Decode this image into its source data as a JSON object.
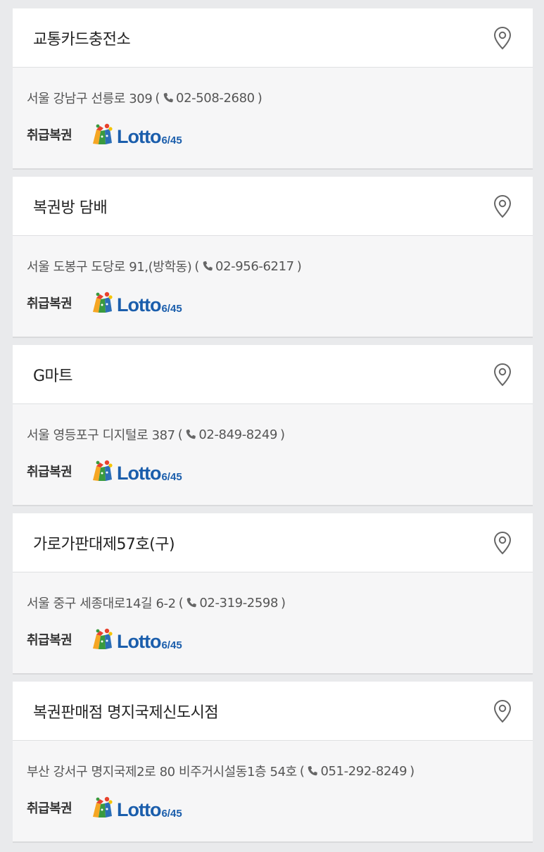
{
  "stores": [
    {
      "name": "교통카드충전소",
      "address": "서울 강남구 선릉로 309",
      "phone": "02-508-2680",
      "products_label": "취급복권",
      "product": "Lotto",
      "product_sub": "6/45"
    },
    {
      "name": "복권방 담배",
      "address": "서울 도봉구 도당로 91,(방학동)",
      "phone": "02-956-6217",
      "products_label": "취급복권",
      "product": "Lotto",
      "product_sub": "6/45"
    },
    {
      "name": "G마트",
      "address": "서울 영등포구 디지털로 387",
      "phone": "02-849-8249",
      "products_label": "취급복권",
      "product": "Lotto",
      "product_sub": "6/45"
    },
    {
      "name": "가로가판대제57호(구)",
      "address": "서울 중구 세종대로14길 6-2",
      "phone": "02-319-2598",
      "products_label": "취급복권",
      "product": "Lotto",
      "product_sub": "6/45"
    },
    {
      "name": "복권판매점 명지국제신도시점",
      "address": "부산 강서구 명지국제2로 80 비주거시설동1층 54호",
      "phone": "051-292-8249",
      "products_label": "취급복권",
      "product": "Lotto",
      "product_sub": "6/45"
    }
  ],
  "icons": {
    "map_pin": "map-pin-icon",
    "phone": "phone-icon",
    "lotto_mascot": "lotto-mascot-icon"
  },
  "colors": {
    "page_bg": "#e9eaec",
    "header_bg": "#ffffff",
    "body_bg": "#f6f6f7",
    "lotto_blue": "#1b5eac"
  }
}
